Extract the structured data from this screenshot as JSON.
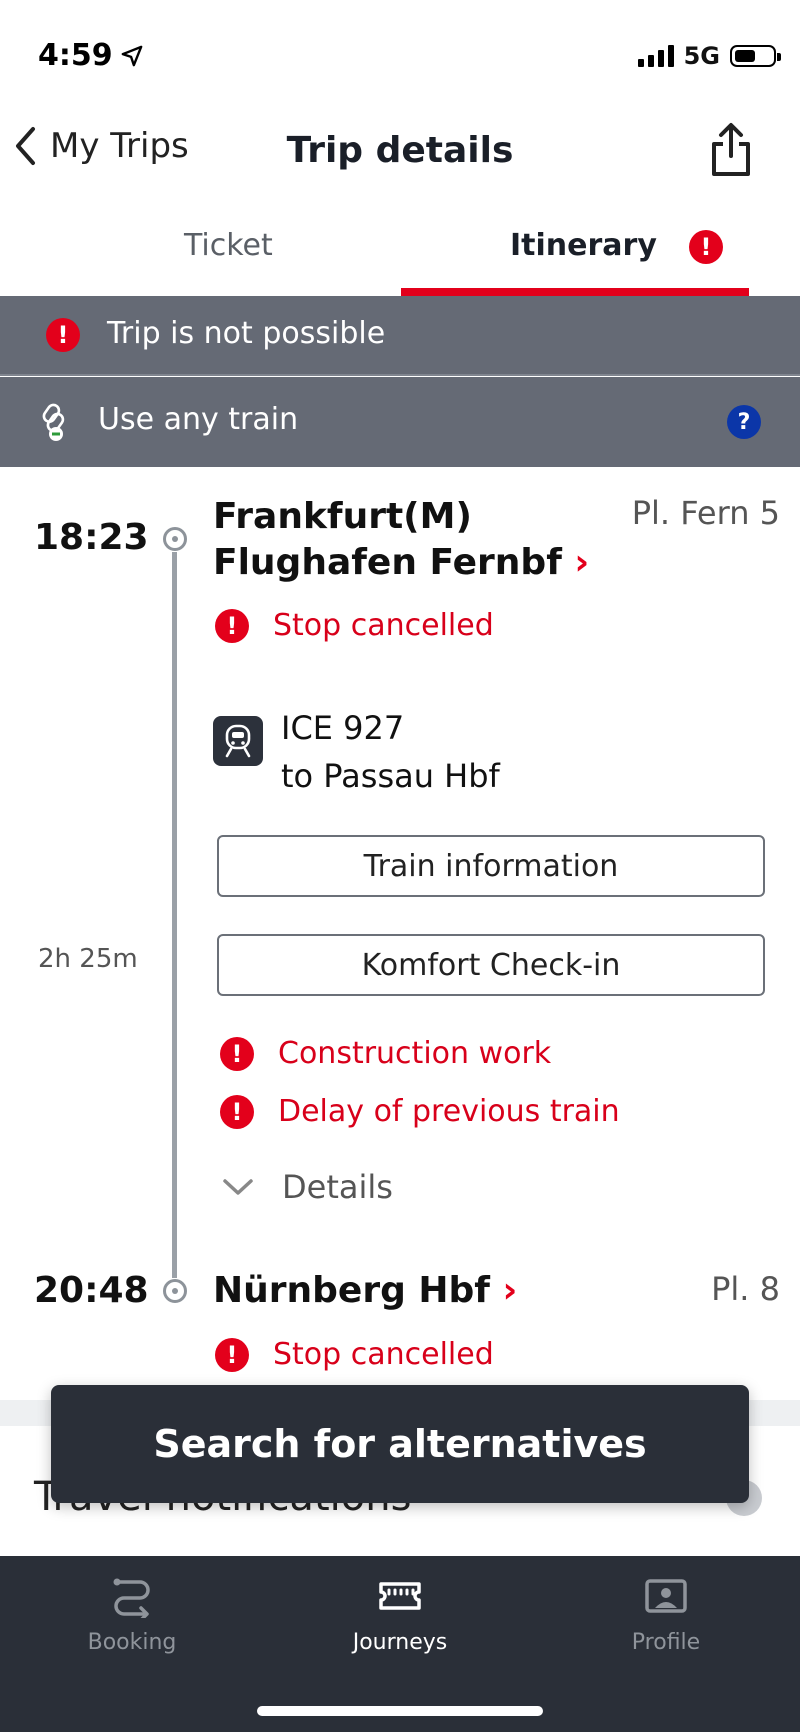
{
  "status_bar": {
    "time": "4:59",
    "network": "5G"
  },
  "nav": {
    "back_label": "My Trips",
    "title": "Trip details"
  },
  "tabs": {
    "ticket": "Ticket",
    "itinerary": "Itinerary",
    "active": "Itinerary"
  },
  "banners": {
    "not_possible": "Trip is not possible",
    "any_train": "Use any train"
  },
  "journey": {
    "departure": {
      "time": "18:23",
      "station_line1": "Frankfurt(M)",
      "station_line2": "Flughafen Fernbf",
      "platform": "Pl. Fern 5",
      "status": "Stop cancelled"
    },
    "train": {
      "name": "ICE 927",
      "destination": "to Passau Hbf"
    },
    "duration": "2h 25m",
    "buttons": {
      "train_info": "Train information",
      "checkin": "Komfort Check-in"
    },
    "notices": [
      "Construction work",
      "Delay of previous train"
    ],
    "details_label": "Details",
    "arrival": {
      "time": "20:48",
      "station": "Nürnberg Hbf",
      "platform": "Pl. 8",
      "status": "Stop cancelled"
    }
  },
  "travel_notifications_label": "Travel notifications",
  "cta_label": "Search for alternatives",
  "tabbar": {
    "items": [
      {
        "label": "Booking",
        "icon": "route-icon"
      },
      {
        "label": "Journeys",
        "icon": "ticket-icon"
      },
      {
        "label": "Profile",
        "icon": "profile-card-icon"
      }
    ],
    "active": "Journeys"
  },
  "colors": {
    "accent_red": "#e3001b",
    "banner_gray": "#656a75",
    "dark": "#2a2f38",
    "help_blue": "#0b36a8"
  }
}
